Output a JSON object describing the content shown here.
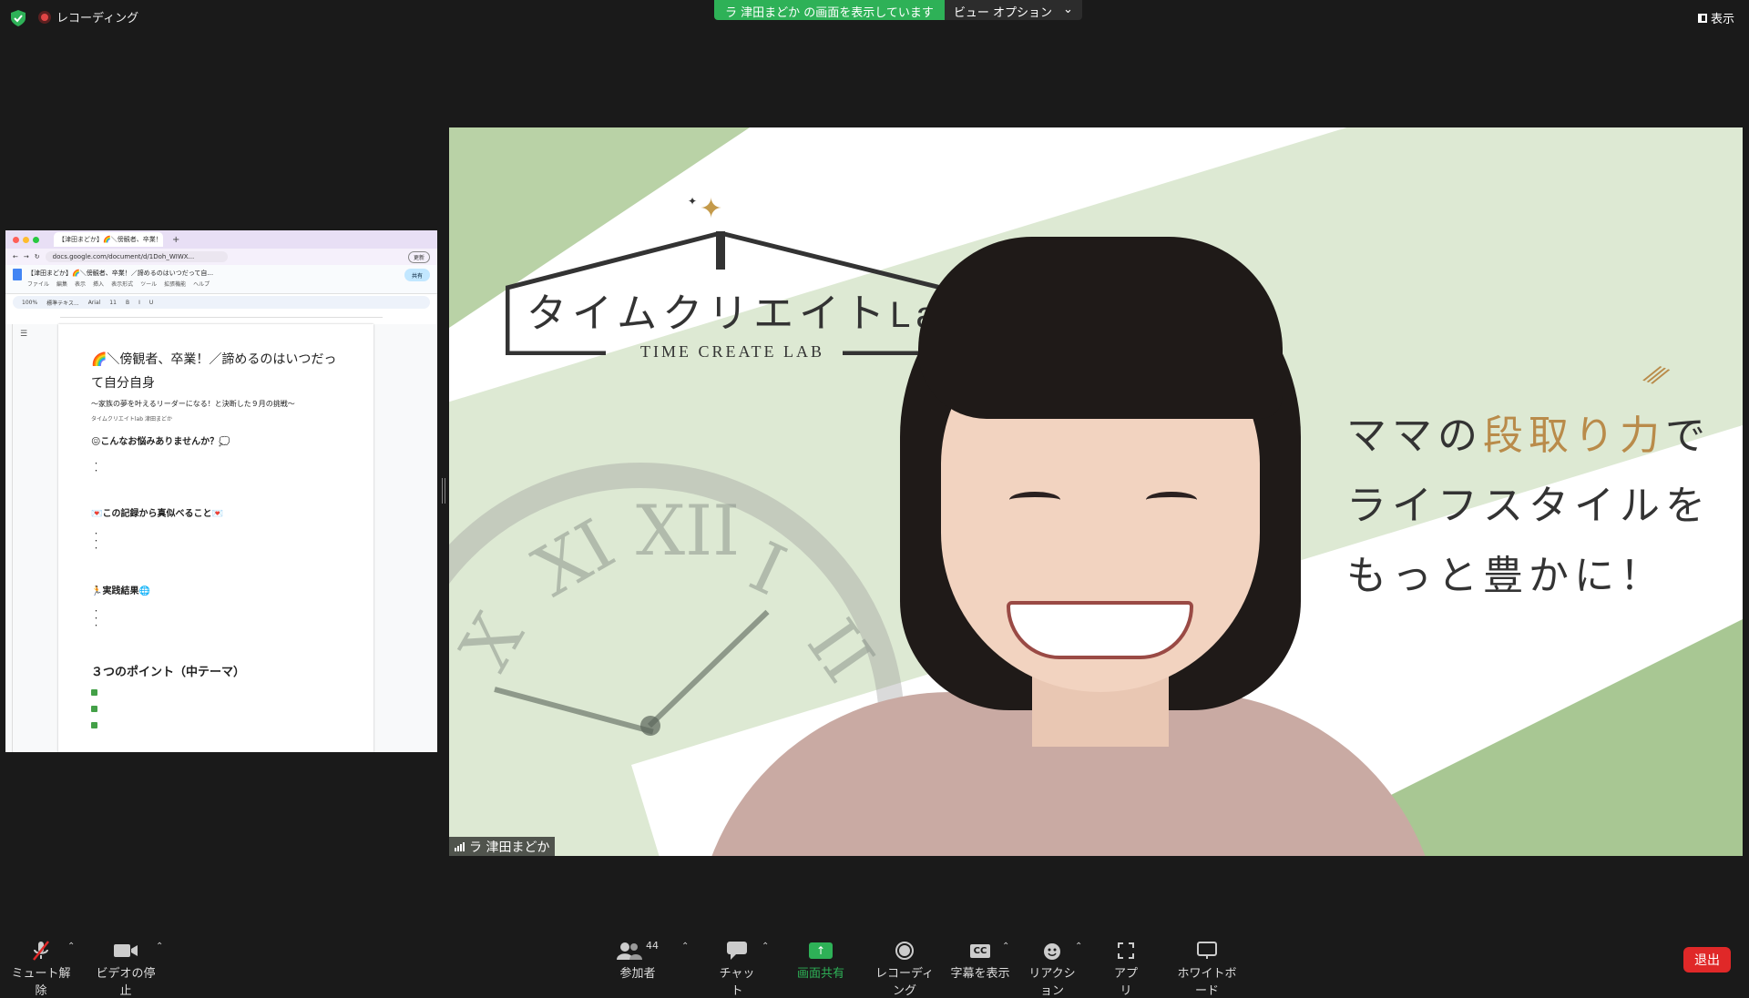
{
  "topbar": {
    "recording_label": "レコーディング",
    "share_banner": "ラ 津田まどか の画面を表示しています",
    "view_options": "ビュー オプション",
    "view_button": "表示"
  },
  "shared_screen": {
    "tab_title": "【津田まどか】🌈＼傍観者、卒業！",
    "url": "docs.google.com/document/d/1Doh_WIWX...",
    "update_label": "更新",
    "doc_title": "【津田まどか】🌈＼傍観者、卒業！／諦めるのはいつだって自...",
    "menu": [
      "ファイル",
      "編集",
      "表示",
      "挿入",
      "表示形式",
      "ツール",
      "拡張機能",
      "ヘルプ"
    ],
    "share_label": "共有",
    "toolbar_zoom": "100%",
    "toolbar_style": "標準テキス...",
    "toolbar_font": "Arial",
    "toolbar_size": "11",
    "heading": "🌈＼傍観者、卒業！／諦めるのはいつだって自分自身",
    "subheading": "〜家族の夢を叶えるリーダーになる！と決断した９月の挑戦〜",
    "author": "タイムクリエイトlab 津田まどか",
    "section1": "😖こんなお悩みありませんか？💭",
    "section2": "💌この記録から真似べること💌",
    "section3": "🏃実践結果🌐",
    "section4": "３つのポイント（中テーマ）",
    "dot": "・"
  },
  "video": {
    "logo_text": "タイムクリエイト",
    "logo_lab": "Lab",
    "logo_sub": "TIME CREATE LAB",
    "tagline_line1_a": "ママの",
    "tagline_line1_gold": "段取り力",
    "tagline_line1_b": "で",
    "tagline_line2": "ライフスタイルを",
    "tagline_line3": "もっと豊かに！",
    "clock_numerals": [
      "XII",
      "I",
      "II",
      "XI",
      "X"
    ],
    "participant_name": "ラ 津田まどか"
  },
  "toolbar": {
    "mute": "ミュート解除",
    "video": "ビデオの停止",
    "participants": "参加者",
    "participants_count": "44",
    "chat": "チャット",
    "share": "画面共有",
    "recording": "レコーディング",
    "captions": "字幕を表示",
    "captions_icon": "CC",
    "reactions": "リアクション",
    "apps": "アプリ",
    "whiteboard": "ホワイトボード",
    "leave": "退出"
  },
  "colors": {
    "accent_green": "#2eb157",
    "leave_red": "#e02828",
    "gold": "#b98b4a"
  }
}
